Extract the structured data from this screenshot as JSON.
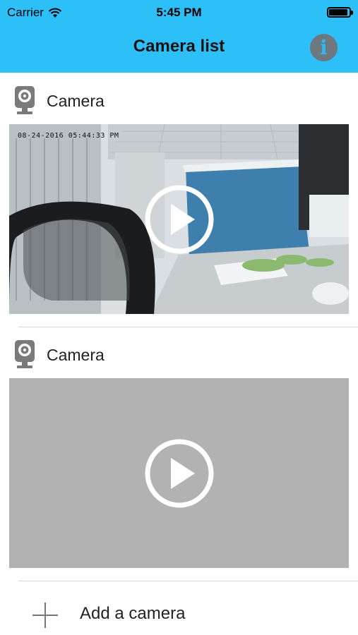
{
  "status_bar": {
    "carrier": "Carrier",
    "time": "5:45 PM",
    "battery_level": 0.92
  },
  "nav": {
    "title": "Camera list",
    "info_icon": "info-icon",
    "info_glyph": "i"
  },
  "cameras": [
    {
      "name": "Camera",
      "icon": "webcam-icon",
      "has_preview": true,
      "timestamp": "08-24-2016 05:44:33 PM",
      "play_icon": "play-icon"
    },
    {
      "name": "Camera",
      "icon": "webcam-icon",
      "has_preview": false,
      "play_icon": "play-icon"
    }
  ],
  "footer": {
    "add_label": "Add a camera",
    "add_icon": "plus-icon"
  },
  "colors": {
    "nav_bar": "#2dc0f8",
    "info_button": "#6d7880",
    "empty_preview": "#b2b2b2"
  }
}
